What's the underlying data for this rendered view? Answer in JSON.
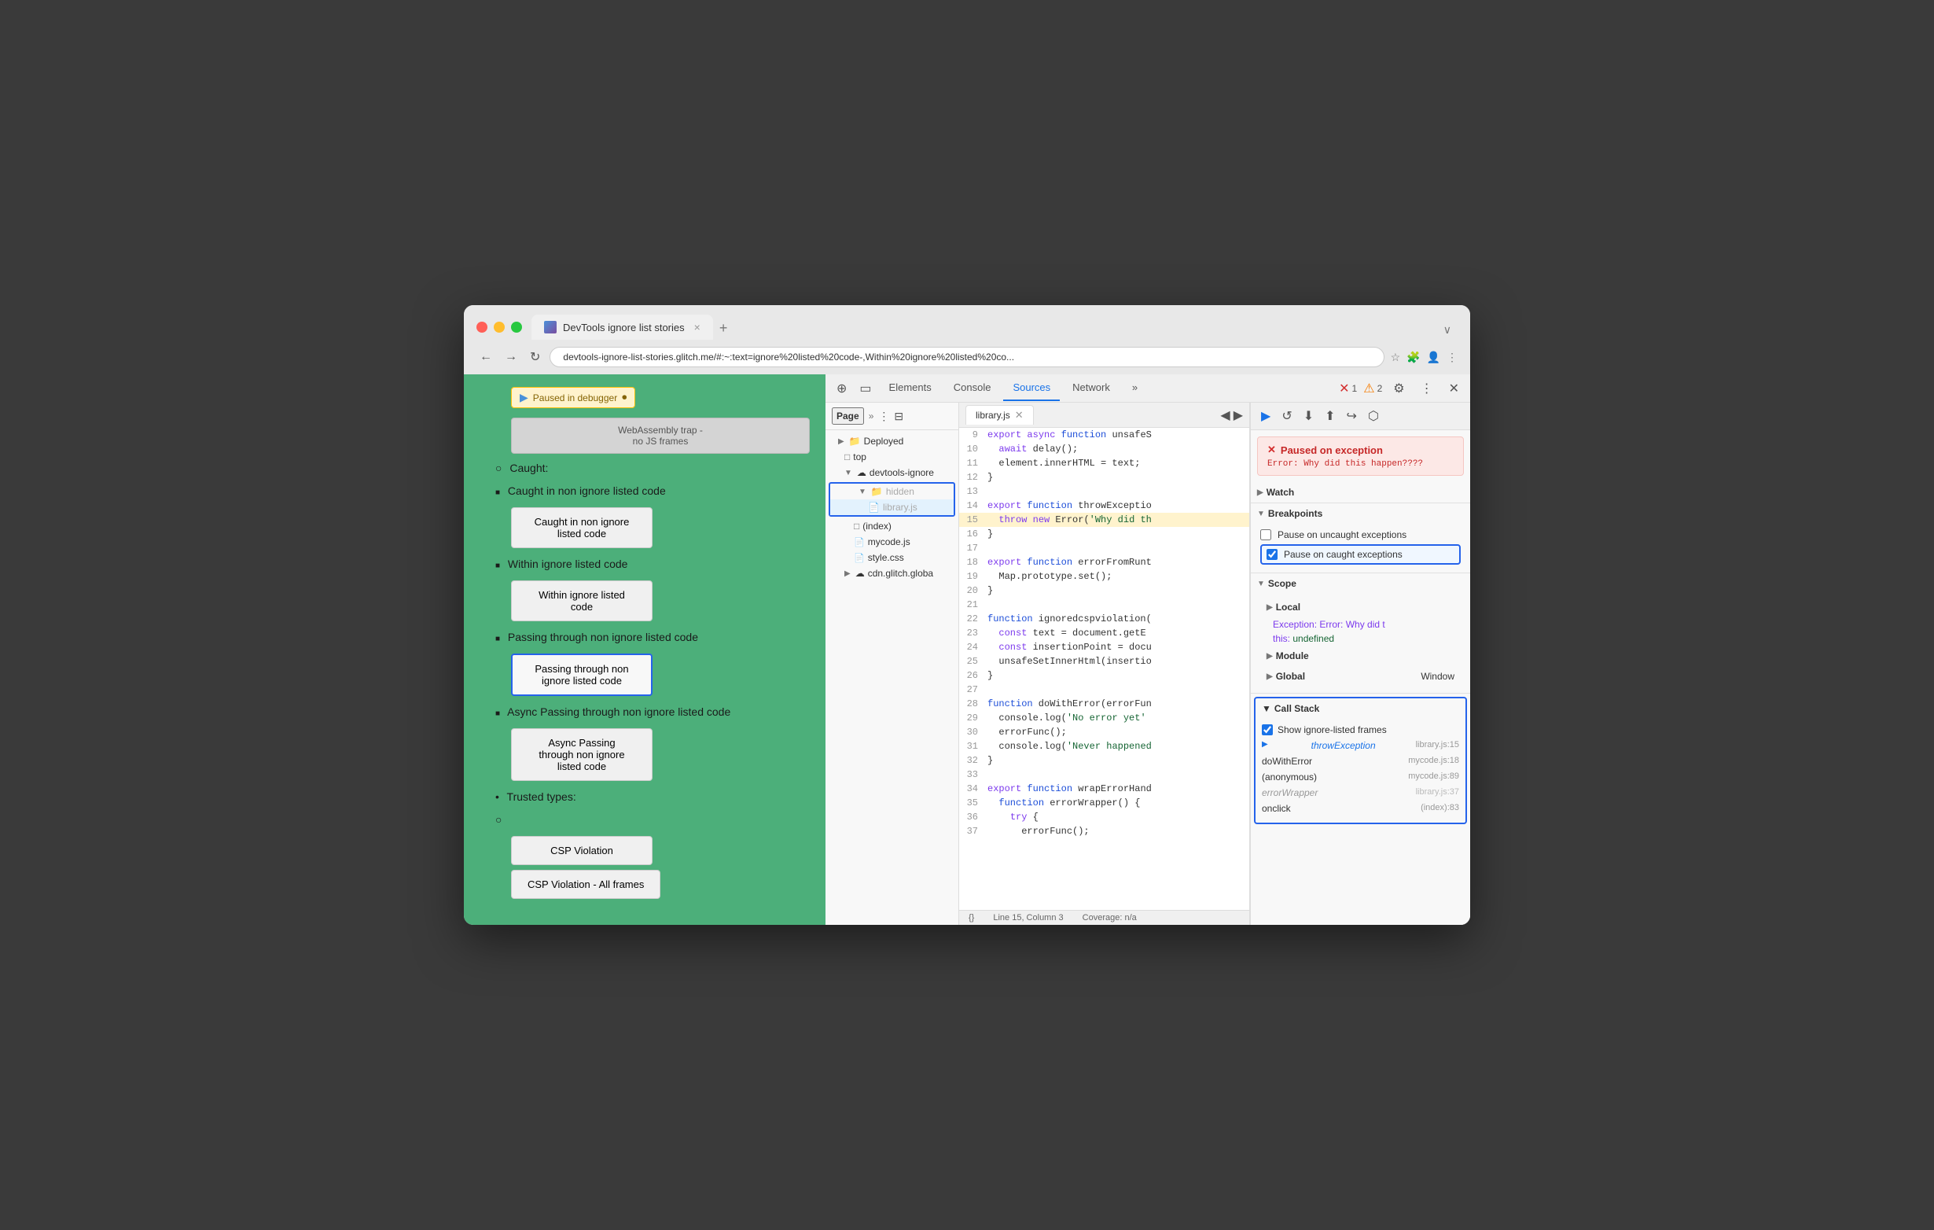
{
  "browser": {
    "title": "DevTools ignore list stories",
    "url": "devtools-ignore-list-stories.glitch.me/#:~:text=ignore%20listed%20code-,Within%20ignore%20listed%20co...",
    "tab_close": "×",
    "tab_new": "+",
    "tab_overflow": "∨"
  },
  "nav": {
    "back": "←",
    "forward": "→",
    "reload": "↻"
  },
  "page": {
    "paused_badge": "Paused in debugger",
    "items": [
      {
        "type": "webassembly",
        "text": "WebAssembly trap -\nno JS frames"
      },
      {
        "type": "heading",
        "indent": 1,
        "text": "Caught:"
      },
      {
        "type": "bullet_square",
        "indent": 2,
        "text": "Caught in non ignore listed code"
      },
      {
        "type": "button",
        "text": "Caught in non ignore\nlisted code",
        "highlighted": false
      },
      {
        "type": "bullet_square",
        "indent": 2,
        "text": "Within ignore listed code"
      },
      {
        "type": "button",
        "text": "Within ignore listed\ncode",
        "highlighted": false
      },
      {
        "type": "bullet_square",
        "indent": 2,
        "text": "Passing through non ignore listed code"
      },
      {
        "type": "button",
        "text": "Passing through non\nignore listed code",
        "highlighted": true
      },
      {
        "type": "bullet_square",
        "indent": 2,
        "text": "Async Passing through non ignore listed code"
      },
      {
        "type": "button",
        "text": "Async Passing\nthrough non ignore\nlisted code",
        "highlighted": false
      },
      {
        "type": "heading",
        "indent": 0,
        "text": "Trusted types:"
      },
      {
        "type": "bullet_circle",
        "indent": 1,
        "text": ""
      },
      {
        "type": "button",
        "text": "CSP Violation",
        "highlighted": false
      },
      {
        "type": "button",
        "text": "CSP Violation - All frames",
        "highlighted": false
      }
    ]
  },
  "devtools": {
    "toolbar": {
      "inspect_icon": "⊕",
      "device_icon": "▭",
      "tabs": [
        "Elements",
        "Console",
        "Sources",
        "Network",
        "»"
      ],
      "active_tab": "Sources",
      "error_count": "1",
      "warning_count": "2",
      "settings_icon": "⚙",
      "more_icon": "⋮",
      "close_icon": "✕"
    },
    "sources": {
      "sidebar_tab": "Page",
      "sidebar_more": "»",
      "sidebar_menu": "⋮",
      "collapse_icon": "⊟",
      "tree": [
        {
          "type": "section",
          "label": "Deployed",
          "indent": 0,
          "expanded": false,
          "icon": "📁"
        },
        {
          "type": "item",
          "label": "top",
          "indent": 1,
          "icon": "□"
        },
        {
          "type": "folder",
          "label": "devtools-ignore",
          "indent": 1,
          "expanded": true,
          "icon": "☁"
        },
        {
          "type": "folder",
          "label": "hidden",
          "indent": 2,
          "expanded": true,
          "icon": "📁",
          "highlighted": true
        },
        {
          "type": "file",
          "label": "library.js",
          "indent": 3,
          "icon": "📄",
          "highlighted": true,
          "active": true
        },
        {
          "type": "item",
          "label": "(index)",
          "indent": 2,
          "icon": "□"
        },
        {
          "type": "file",
          "label": "mycode.js",
          "indent": 2,
          "icon": "📄"
        },
        {
          "type": "file",
          "label": "style.css",
          "indent": 2,
          "icon": "📄"
        },
        {
          "type": "folder",
          "label": "cdn.glitch.globa",
          "indent": 1,
          "expanded": false,
          "icon": "☁"
        }
      ],
      "editor": {
        "filename": "library.js",
        "lines": [
          {
            "num": 9,
            "content": "export async function unsafeS",
            "type": "normal"
          },
          {
            "num": 10,
            "content": "  await delay();",
            "type": "normal"
          },
          {
            "num": 11,
            "content": "  element.innerHTML = text;",
            "type": "normal"
          },
          {
            "num": 12,
            "content": "}",
            "type": "normal"
          },
          {
            "num": 13,
            "content": "",
            "type": "normal"
          },
          {
            "num": 14,
            "content": "export function throwExceptio",
            "type": "normal"
          },
          {
            "num": 15,
            "content": "  throw new Error('Why did th",
            "type": "highlighted"
          },
          {
            "num": 16,
            "content": "}",
            "type": "normal"
          },
          {
            "num": 17,
            "content": "",
            "type": "normal"
          },
          {
            "num": 18,
            "content": "export function errorFromRunt",
            "type": "normal"
          },
          {
            "num": 19,
            "content": "  Map.prototype.set();",
            "type": "normal"
          },
          {
            "num": 20,
            "content": "}",
            "type": "normal"
          },
          {
            "num": 21,
            "content": "",
            "type": "normal"
          },
          {
            "num": 22,
            "content": "function ignoredcspviolation(",
            "type": "normal"
          },
          {
            "num": 23,
            "content": "  const text = document.getE",
            "type": "normal"
          },
          {
            "num": 24,
            "content": "  const insertionPoint = docu",
            "type": "normal"
          },
          {
            "num": 25,
            "content": "  unsafeSetInnerHtml(insertio",
            "type": "normal"
          },
          {
            "num": 26,
            "content": "}",
            "type": "normal"
          },
          {
            "num": 27,
            "content": "",
            "type": "normal"
          },
          {
            "num": 28,
            "content": "function doWithError(errorFun",
            "type": "normal"
          },
          {
            "num": 29,
            "content": "  console.log('No error yet'",
            "type": "normal"
          },
          {
            "num": 30,
            "content": "  errorFunc();",
            "type": "normal"
          },
          {
            "num": 31,
            "content": "  console.log('Never happened",
            "type": "normal"
          },
          {
            "num": 32,
            "content": "}",
            "type": "normal"
          },
          {
            "num": 33,
            "content": "",
            "type": "normal"
          },
          {
            "num": 34,
            "content": "export function wrapErrorHand",
            "type": "normal"
          },
          {
            "num": 35,
            "content": "  function errorWrapper() {",
            "type": "normal"
          },
          {
            "num": 36,
            "content": "    try {",
            "type": "normal"
          },
          {
            "num": 37,
            "content": "      errorFunc();",
            "type": "normal"
          }
        ],
        "status_line": "Line 15, Column 3",
        "status_coverage": "Coverage: n/a"
      }
    },
    "right_panel": {
      "toolbar_buttons": [
        "▶",
        "↺",
        "⬇",
        "⬆",
        "↪",
        "⬡"
      ],
      "exception": {
        "title": "Paused on exception",
        "message": "Error: Why did this\nhappen????"
      },
      "watch": {
        "label": "Watch",
        "collapsed": true
      },
      "breakpoints": {
        "label": "Breakpoints",
        "items": [
          {
            "label": "Pause on uncaught exceptions",
            "checked": false
          },
          {
            "label": "Pause on caught exceptions",
            "checked": true,
            "highlighted": true
          }
        ]
      },
      "scope": {
        "label": "Scope",
        "items": [
          {
            "label": "Local",
            "items": [
              {
                "key": "Exception: Error: Why did t",
                "val": ""
              },
              {
                "key": "this:",
                "val": "undefined"
              }
            ]
          },
          {
            "label": "Module",
            "collapsed": true
          },
          {
            "label": "Global",
            "val": "Window"
          }
        ]
      },
      "call_stack": {
        "label": "Call Stack",
        "show_ignored": true,
        "show_ignored_label": "Show ignore-listed frames",
        "frames": [
          {
            "name": "throwException",
            "loc": "library.js:15",
            "active": true,
            "dim": false
          },
          {
            "name": "doWithError",
            "loc": "mycode.js:18",
            "active": false,
            "dim": false
          },
          {
            "name": "(anonymous)",
            "loc": "mycode.js:89",
            "active": false,
            "dim": false
          },
          {
            "name": "errorWrapper",
            "loc": "library.js:37",
            "active": false,
            "dim": true
          },
          {
            "name": "onclick",
            "loc": "(index):83",
            "active": false,
            "dim": false
          }
        ]
      }
    }
  }
}
